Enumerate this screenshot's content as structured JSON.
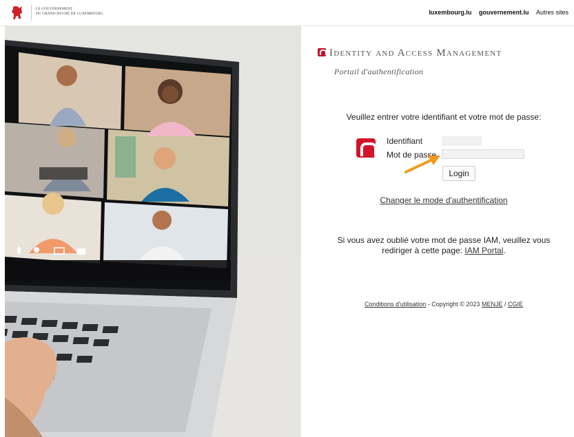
{
  "header": {
    "gov_line1": "LE GOUVERNEMENT",
    "gov_line2": "DU GRAND-DUCHÉ DE LUXEMBOURG",
    "links": [
      "luxembourg.lu",
      "gouvernement.lu",
      "Autres sites"
    ]
  },
  "brand": {
    "title": "Identity and Access Management",
    "subtitle": "Portail d'authentification",
    "accent_color": "#c8102e"
  },
  "form": {
    "prompt": "Veuillez entrer votre identifiant et votre mot de passe:",
    "username_label": "Identifiant",
    "username_value": "",
    "password_label": "Mot de passe",
    "password_value": "",
    "login_button": "Login"
  },
  "change_auth_link": "Changer le mode d'authentification",
  "forgot": {
    "text": "Si vous avez oublié votre mot de passe IAM, veuillez vous rediriger à cette page:",
    "link": "IAM Portal",
    "end": "."
  },
  "footer": {
    "terms": "Conditions d'utilisation",
    "copyright": "- Copyright © 2023",
    "org1": "MENJE",
    "sep": "/",
    "org2": "CGIE"
  },
  "hero": {
    "video_toolbar_icons": [
      "microphone-icon",
      "user-icon",
      "screen-share-icon",
      "camera-icon"
    ]
  }
}
